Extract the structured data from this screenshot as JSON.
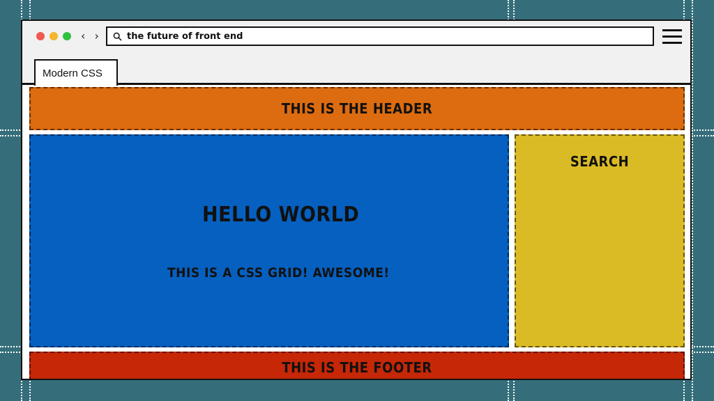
{
  "colors": {
    "background": "#356e7a",
    "header": "#dd6b0f",
    "main": "#0660c0",
    "aside": "#dbbb25",
    "footer": "#c52707",
    "dot_red": "#ee5a50",
    "dot_yellow": "#f5b62e",
    "dot_green": "#2fc140"
  },
  "browser": {
    "nav_arrows": "‹ ›",
    "address": "the future of front end",
    "tab_label": "Modern CSS",
    "icons": [
      "search-icon",
      "hamburger-menu-icon"
    ]
  },
  "page": {
    "header": "THIS IS THE HEADER",
    "main_title": "HELLO WORLD",
    "main_subtitle": "THIS IS A CSS GRID! AWESOME!",
    "aside": "SEARCH",
    "footer": "THIS IS THE FOOTER"
  }
}
